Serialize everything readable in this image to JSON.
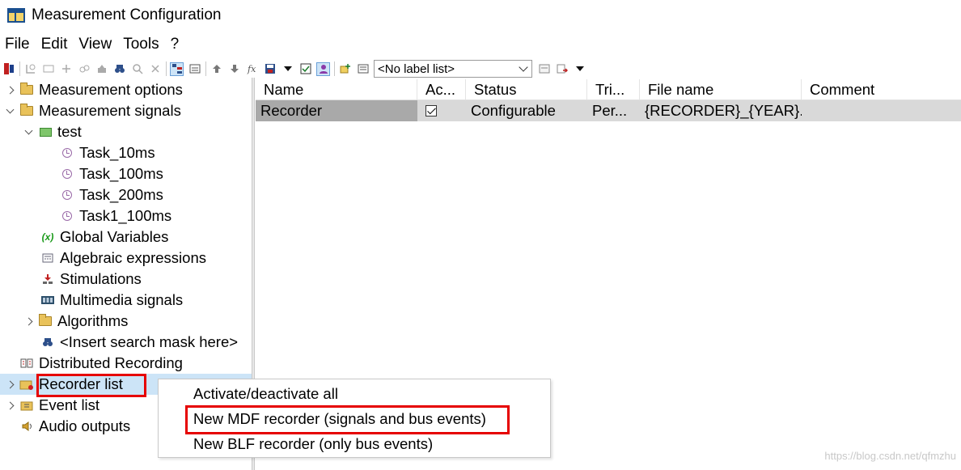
{
  "window": {
    "title": "Measurement Configuration"
  },
  "menu": {
    "items": [
      "File",
      "Edit",
      "View",
      "Tools",
      "?"
    ]
  },
  "toolbar": {
    "label_list": "<No label list>"
  },
  "tree": {
    "measurement_options": "Measurement options",
    "measurement_signals": "Measurement signals",
    "test": "test",
    "task_10ms": "Task_10ms",
    "task_100ms": "Task_100ms",
    "task_200ms": "Task_200ms",
    "task1_100ms": "Task1_100ms",
    "global_variables": "Global Variables",
    "global_variables_icon": "(x)",
    "algebraic_expressions": "Algebraic expressions",
    "stimulations": "Stimulations",
    "multimedia_signals": "Multimedia signals",
    "algorithms": "Algorithms",
    "search_mask": "<Insert search mask here>",
    "distributed_recording": "Distributed Recording",
    "recorder_list": "Recorder list",
    "event_list": "Event list",
    "audio_outputs": "Audio outputs"
  },
  "table": {
    "columns": [
      "Name",
      "Ac...",
      "Status",
      "Tri...",
      "File name",
      "Comment"
    ],
    "rows": [
      {
        "name": "Recorder",
        "status": "Configurable",
        "trigger": "Per...",
        "file_name": "{RECORDER}_{YEAR}...",
        "comment": ""
      }
    ]
  },
  "context_menu": {
    "items": [
      "Activate/deactivate all",
      "New MDF recorder (signals and bus events)",
      "New BLF recorder (only bus events)"
    ]
  },
  "watermark": "https://blog.csdn.net/qfmzhu"
}
